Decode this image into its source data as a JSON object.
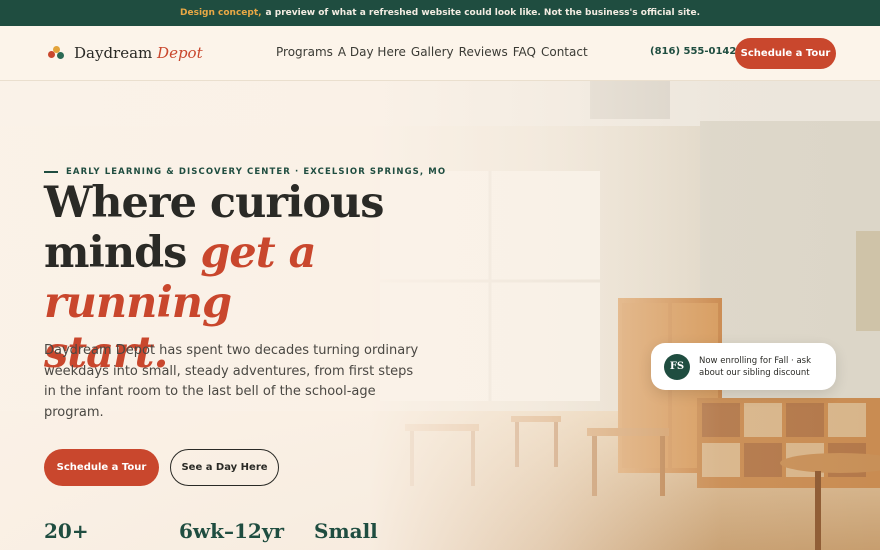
{
  "banner": {
    "highlight": "Design concept,",
    "text": "a preview of what a refreshed website could look like. Not the business's official site."
  },
  "header": {
    "logo_primary": "Daydream",
    "logo_accent": "Depot",
    "nav": [
      "Programs",
      "A Day Here",
      "Gallery",
      "Reviews",
      "FAQ",
      "Contact"
    ],
    "phone": "(816) 555-0142",
    "cta": "Schedule a Tour"
  },
  "hero": {
    "eyebrow": "EARLY LEARNING & DISCOVERY CENTER · EXCELSIOR SPRINGS, MO",
    "headline_line1": "Where curious",
    "headline_line2": "minds",
    "headline_accent_line2": "get a running",
    "headline_accent_line3": "start.",
    "lead": "Daydream Depot has spent two decades turning ordinary weekdays into small, steady adventures, from first steps in the infant room to the last bell of the school-age program.",
    "primary_cta": "Schedule a Tour",
    "secondary_cta": "See a Day Here",
    "stats": [
      "20+",
      "6wk–12yr",
      "Small"
    ]
  },
  "badge": {
    "initials": "FS",
    "text": "Now enrolling for Fall · ask about our sibling discount"
  },
  "colors": {
    "brand_green": "#1f4d40",
    "accent_red": "#c9472d",
    "accent_gold": "#e3a33a",
    "cream": "#fbf2e8"
  }
}
